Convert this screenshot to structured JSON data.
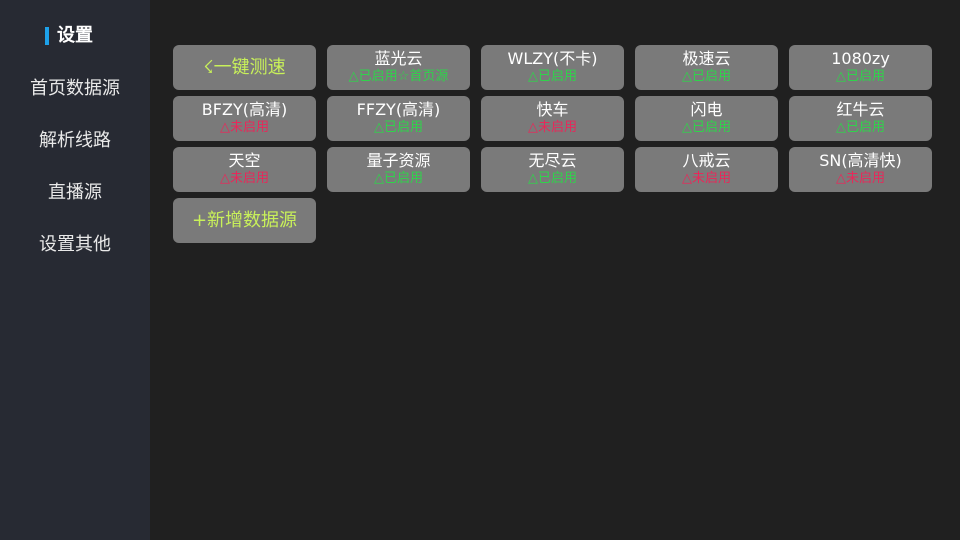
{
  "colors": {
    "accent": "#1da1ea",
    "enabled": "#2fd44b",
    "disabled": "#e8285a",
    "action_text": "#c8f05a"
  },
  "sidebar": {
    "items": [
      {
        "label": "设置",
        "active": true
      },
      {
        "label": "首页数据源"
      },
      {
        "label": "解析线路"
      },
      {
        "label": "直播源"
      },
      {
        "label": "设置其他"
      }
    ]
  },
  "actions": {
    "speed_test": "☇一键测速",
    "add_source": "+新增数据源"
  },
  "sources": [
    {
      "name": "蓝光云",
      "status": "△已启用☆首页源",
      "enabled": true
    },
    {
      "name": "WLZY(不卡)",
      "status": "△已启用",
      "enabled": true
    },
    {
      "name": "极速云",
      "status": "△已启用",
      "enabled": true
    },
    {
      "name": "1080zy",
      "status": "△已启用",
      "enabled": true
    },
    {
      "name": "BFZY(高清)",
      "status": "△未启用",
      "enabled": false
    },
    {
      "name": "FFZY(高清)",
      "status": "△已启用",
      "enabled": true
    },
    {
      "name": "快车",
      "status": "△未启用",
      "enabled": false
    },
    {
      "name": "闪电",
      "status": "△已启用",
      "enabled": true
    },
    {
      "name": "红牛云",
      "status": "△已启用",
      "enabled": true
    },
    {
      "name": "天空",
      "status": "△未启用",
      "enabled": false
    },
    {
      "name": "量子资源",
      "status": "△已启用",
      "enabled": true
    },
    {
      "name": "无尽云",
      "status": "△已启用",
      "enabled": true
    },
    {
      "name": "八戒云",
      "status": "△未启用",
      "enabled": false
    },
    {
      "name": "SN(高清快)",
      "status": "△未启用",
      "enabled": false
    }
  ]
}
